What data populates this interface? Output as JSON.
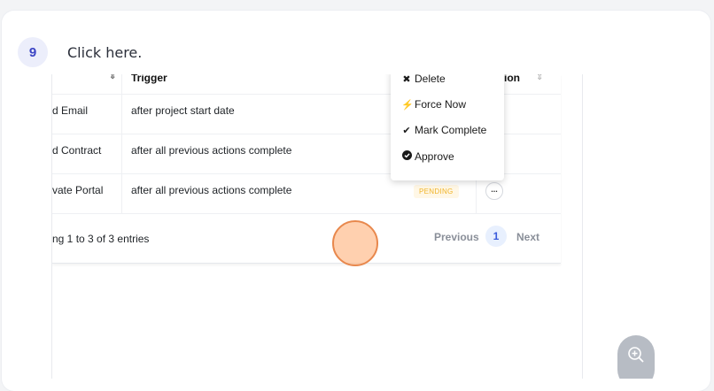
{
  "step": {
    "number": "9",
    "instruction": "Click here."
  },
  "table": {
    "headers": {
      "col1_sort": "⇕",
      "trigger": "Trigger",
      "action_partial": "ion",
      "action_sort": "⇕"
    },
    "rows": [
      {
        "name": "d Email",
        "trigger": "after project start date"
      },
      {
        "name": "d Contract",
        "trigger": "after all previous actions complete"
      },
      {
        "name": "vate Portal",
        "trigger": "after all previous actions complete",
        "status": "PENDING"
      }
    ],
    "footer": {
      "entries_text": "ng 1 to 3 of 3 entries",
      "previous": "Previous",
      "page": "1",
      "next": "Next"
    }
  },
  "menu": {
    "items": [
      {
        "label": "Delete",
        "icon": "close-icon"
      },
      {
        "label": "Force Now",
        "icon": "bolt-icon"
      },
      {
        "label": "Mark Complete",
        "icon": "check-icon"
      },
      {
        "label": "Approve",
        "icon": "check-circle-icon"
      }
    ]
  },
  "more_button": "...",
  "colors": {
    "accent": "#3b44c4",
    "pending": "#f0b429",
    "marker": "#e8884d"
  }
}
